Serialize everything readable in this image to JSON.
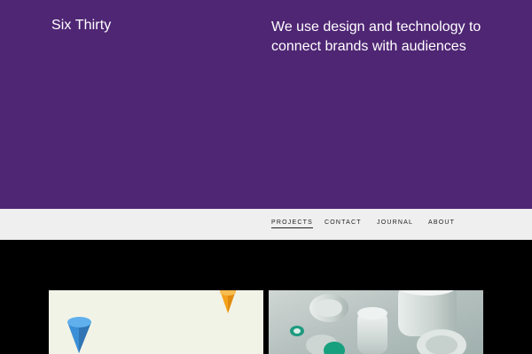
{
  "header": {
    "brand": "Six Thirty",
    "tagline": "We use design and technology to connect brands with audiences"
  },
  "nav": {
    "items": [
      {
        "label": "PROJECTS",
        "active": true
      },
      {
        "label": "CONTACT",
        "active": false
      },
      {
        "label": "JOURNAL",
        "active": false
      },
      {
        "label": "ABOUT",
        "active": false
      }
    ]
  },
  "projects": {
    "tiles": [
      {
        "image": "abstract-cones-illustration"
      },
      {
        "image": "3d-cups-render"
      }
    ]
  },
  "colors": {
    "hero_background": "#4f2674",
    "nav_background": "#efefef",
    "page_background": "#000000",
    "cone_blue": "#3b8fd6",
    "cone_orange": "#f4a21c",
    "accent_teal": "#1e9a7f"
  }
}
